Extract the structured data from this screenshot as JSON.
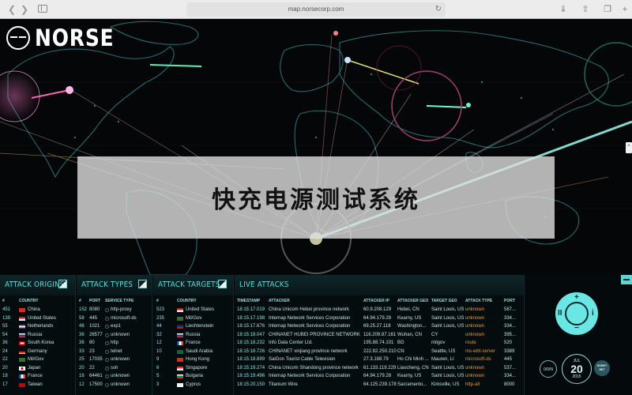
{
  "browser": {
    "url": "map.norsecorp.com",
    "back_icon": "chevron-left-icon",
    "forward_icon": "chevron-right-icon",
    "reload_icon": "reload-icon"
  },
  "logo": {
    "text": "NORSE"
  },
  "banner": {
    "text": "快充电源测试系统"
  },
  "panels": {
    "origins": {
      "title": "ATTACK ORIGINS",
      "headers": [
        "#",
        "COUNTRY"
      ],
      "rows": [
        {
          "n": "451",
          "country": "China",
          "flag": "cn"
        },
        {
          "n": "139",
          "country": "United States",
          "flag": "us"
        },
        {
          "n": "55",
          "country": "Netherlands",
          "flag": "nl"
        },
        {
          "n": "54",
          "country": "Russia",
          "flag": "ru"
        },
        {
          "n": "36",
          "country": "South Korea",
          "flag": "kr"
        },
        {
          "n": "24",
          "country": "Germany",
          "flag": "de"
        },
        {
          "n": "22",
          "country": "Mil/Gov",
          "flag": "mil"
        },
        {
          "n": "20",
          "country": "Japan",
          "flag": "jp"
        },
        {
          "n": "18",
          "country": "France",
          "flag": "fr"
        },
        {
          "n": "17",
          "country": "Taiwan",
          "flag": "tw"
        }
      ]
    },
    "types": {
      "title": "ATTACK TYPES",
      "headers": [
        "#",
        "PORT",
        "SERVICE TYPE"
      ],
      "rows": [
        {
          "n": "152",
          "port": "8080",
          "service": "http-proxy"
        },
        {
          "n": "58",
          "port": "445",
          "service": "microsoft-ds"
        },
        {
          "n": "48",
          "port": "1021",
          "service": "exp1"
        },
        {
          "n": "36",
          "port": "26577",
          "service": "unknown"
        },
        {
          "n": "36",
          "port": "80",
          "service": "http"
        },
        {
          "n": "33",
          "port": "23",
          "service": "telnet"
        },
        {
          "n": "25",
          "port": "17035",
          "service": "unknown"
        },
        {
          "n": "20",
          "port": "22",
          "service": "ssh"
        },
        {
          "n": "16",
          "port": "64461",
          "service": "unknown"
        },
        {
          "n": "12",
          "port": "17500",
          "service": "unknown"
        }
      ]
    },
    "targets": {
      "title": "ATTACK TARGETS",
      "headers": [
        "#",
        "COUNTRY"
      ],
      "rows": [
        {
          "n": "523",
          "country": "United States",
          "flag": "us"
        },
        {
          "n": "235",
          "country": "Mil/Gov",
          "flag": "mil"
        },
        {
          "n": "44",
          "country": "Liechtenstein",
          "flag": "li"
        },
        {
          "n": "32",
          "country": "Russia",
          "flag": "ru"
        },
        {
          "n": "12",
          "country": "France",
          "flag": "fr"
        },
        {
          "n": "10",
          "country": "Saudi Arabia",
          "flag": "sa"
        },
        {
          "n": "9",
          "country": "Hong Kong",
          "flag": "hk"
        },
        {
          "n": "6",
          "country": "Singapore",
          "flag": "sg"
        },
        {
          "n": "5",
          "country": "Bulgaria",
          "flag": "bg"
        },
        {
          "n": "3",
          "country": "Cyprus",
          "flag": "cy"
        }
      ]
    },
    "live": {
      "title": "LIVE ATTACKS",
      "headers": [
        "TIMESTAMP",
        "ATTACKER",
        "ATTACKER IP",
        "ATTACKER GEO",
        "TARGET GEO",
        "ATTACK TYPE",
        "PORT"
      ],
      "rows": [
        {
          "ts": "18:15:17.019",
          "attacker": "China Unicom Hebei province network",
          "ip": "60.9.208.129",
          "geo": "Hebei, CN",
          "target": "Saint Louis, US",
          "type": "unknown",
          "port": "587..."
        },
        {
          "ts": "18:15:17.198",
          "attacker": "Internap Network Services Corporation",
          "ip": "64.94.179.28",
          "geo": "Kearny, US",
          "target": "Saint Louis, US",
          "type": "unknown",
          "port": "334..."
        },
        {
          "ts": "18:15:17.676",
          "attacker": "Internap Network Services Corporation",
          "ip": "69.25.27.118",
          "geo": "Washington...",
          "target": "Saint Louis, US",
          "type": "unknown",
          "port": "334..."
        },
        {
          "ts": "18:15:18.047",
          "attacker": "CHINANET HUBEI PROVINCE NETWORK",
          "ip": "116.209.87.161",
          "geo": "Wuhan, CN",
          "target": "CY",
          "type": "unknown",
          "port": "395..."
        },
        {
          "ts": "18:15:18.232",
          "attacker": "Info Data Center Ltd.",
          "ip": "195.88.74.101",
          "geo": "BG",
          "target": "milgov",
          "type": "route",
          "port": "520"
        },
        {
          "ts": "18:15:18.726",
          "attacker": "CHINANET xinjiang province network",
          "ip": "222.82.250.210",
          "geo": "CN",
          "target": "Seattle, US",
          "type": "ms-wbt-server",
          "port": "3389"
        },
        {
          "ts": "18:15:18.899",
          "attacker": "SaiGon Tourist Cable Television",
          "ip": "27.3.188.79",
          "geo": "Ho Chi Minh ...",
          "target": "Mauren, LI",
          "type": "microsoft-ds",
          "port": "445"
        },
        {
          "ts": "18:15:19.274",
          "attacker": "China Unicom Shandong province network",
          "ip": "61.133.119.229",
          "geo": "Liaocheng, CN",
          "target": "Saint Louis, US",
          "type": "unknown",
          "port": "537..."
        },
        {
          "ts": "18:15:19.496",
          "attacker": "Internap Network Services Corporation",
          "ip": "64.94.179.28",
          "geo": "Kearny, US",
          "target": "Saint Louis, US",
          "type": "unknown",
          "port": "334..."
        },
        {
          "ts": "18:15:20.150",
          "attacker": "Titanium Wire",
          "ip": "64.125.239.178",
          "geo": "Sacramento...",
          "target": "Kirksville, US",
          "type": "http-alt",
          "port": "8000"
        }
      ]
    }
  },
  "controls": {
    "up": "+",
    "down": "−",
    "left": "II",
    "right": "i",
    "date_month": "JUL",
    "date_day": "20",
    "date_year": "2015",
    "speed": "0/0/N",
    "badge": "HONEY NET"
  },
  "colors": {
    "accent": "#59d7d4",
    "orange": "#e29a37"
  }
}
